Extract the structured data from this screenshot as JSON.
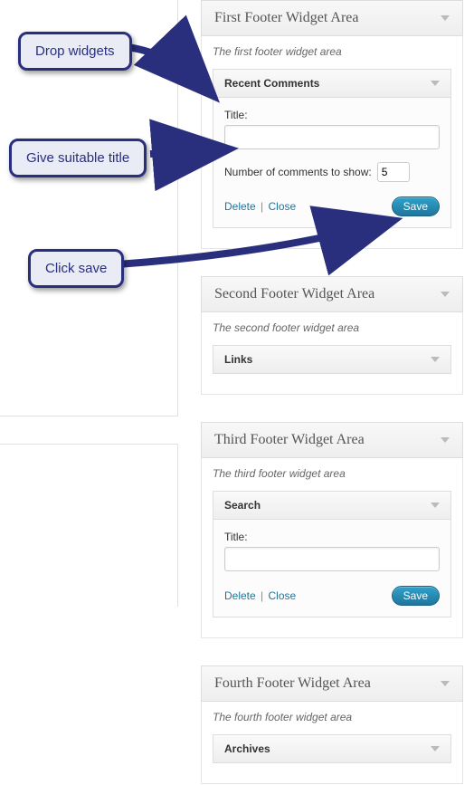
{
  "callouts": {
    "drop": "Drop widgets",
    "title": "Give suitable title",
    "save": "Click save"
  },
  "areas": {
    "first": {
      "title": "First Footer Widget Area",
      "desc": "The first footer widget area",
      "widget": {
        "name": "Recent Comments",
        "titleLabel": "Title:",
        "titleValue": "",
        "numLabel": "Number of comments to show:",
        "numValue": "5",
        "delete": "Delete",
        "close": "Close",
        "save": "Save"
      }
    },
    "second": {
      "title": "Second Footer Widget Area",
      "desc": "The second footer widget area",
      "widget": {
        "name": "Links"
      }
    },
    "third": {
      "title": "Third Footer Widget Area",
      "desc": "The third footer widget area",
      "widget": {
        "name": "Search",
        "titleLabel": "Title:",
        "titleValue": "",
        "delete": "Delete",
        "close": "Close",
        "save": "Save"
      }
    },
    "fourth": {
      "title": "Fourth Footer Widget Area",
      "desc": "The fourth footer widget area",
      "widget": {
        "name": "Archives"
      }
    }
  }
}
